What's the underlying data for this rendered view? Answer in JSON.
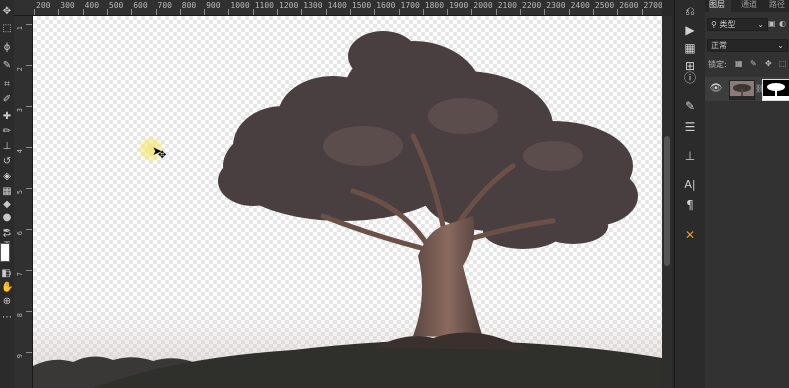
{
  "ruler": {
    "top_labels": [
      "200",
      "300",
      "400",
      "500",
      "600",
      "700",
      "800",
      "900",
      "1000",
      "1100",
      "1200",
      "1300",
      "1400",
      "1500",
      "1600",
      "1700",
      "1800",
      "1900",
      "2000",
      "2100",
      "2200",
      "2300",
      "2400",
      "2500",
      "2600",
      "2700"
    ],
    "left_labels": [
      "1",
      "2",
      "3",
      "4",
      "5",
      "6",
      "7",
      "8",
      "9"
    ]
  },
  "layers_panel": {
    "tabs": [
      "图层",
      "通道",
      "路径"
    ],
    "filter_kind": "类型",
    "blend_mode": "正常",
    "lock_label": "锁定:"
  },
  "colors": {
    "canvas_checker": "#e6e6e6",
    "tree_trunk": "#6b5048",
    "foliage": "#4a3f40",
    "ground": "#2f2f2b",
    "cursor_highlight": "#f5e87a"
  },
  "icons": {
    "left_toolbar": [
      "move-icon",
      "marquee-icon",
      "lasso-icon",
      "quick-select-icon",
      "crop-icon",
      "eyedropper-icon",
      "healing-brush-icon",
      "brush-icon",
      "stamp-icon",
      "history-brush-icon",
      "eraser-icon",
      "gradient-icon",
      "blur-icon",
      "dodge-icon",
      "pen-icon",
      "type-icon",
      "path-select-icon",
      "shape-icon",
      "hand-icon",
      "zoom-icon"
    ],
    "right_strip": [
      "history-icon",
      "play-icon",
      "color-swatch-icon",
      "adjust-icon",
      "info-icon",
      "brush-settings-icon",
      "sliders-icon",
      "clone-source-icon",
      "character-icon",
      "paragraph-icon",
      "tool-presets-icon"
    ]
  }
}
